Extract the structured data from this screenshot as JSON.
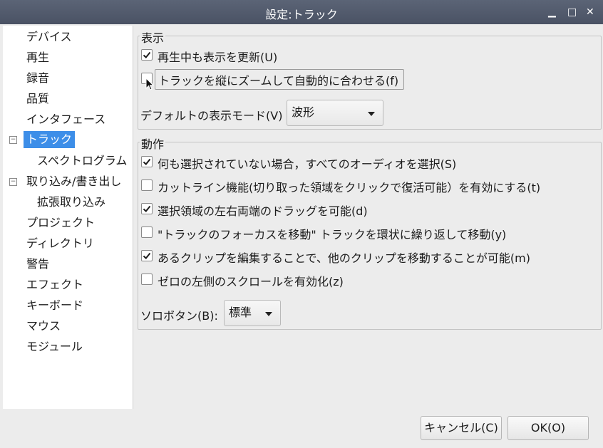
{
  "window": {
    "title": "設定:トラック",
    "minimize_glyph": "▁",
    "maximize_glyph": "□",
    "close_glyph": "✕"
  },
  "sidebar": {
    "items": [
      {
        "label": "デバイス"
      },
      {
        "label": "再生"
      },
      {
        "label": "録音"
      },
      {
        "label": "品質"
      },
      {
        "label": "インタフェース"
      },
      {
        "label": "トラック",
        "selected": true,
        "expanded": true
      },
      {
        "label": "スペクトログラム",
        "child": true
      },
      {
        "label": "取り込み/書き出し",
        "expanded": true
      },
      {
        "label": "拡張取り込み",
        "child": true
      },
      {
        "label": "プロジェクト"
      },
      {
        "label": "ディレクトリ"
      },
      {
        "label": "警告"
      },
      {
        "label": "エフェクト"
      },
      {
        "label": "キーボード"
      },
      {
        "label": "マウス"
      },
      {
        "label": "モジュール"
      }
    ],
    "toggle_glyph": "−"
  },
  "display_group": {
    "title": "表示",
    "update_display": {
      "label": "再生中も表示を更新(U)",
      "checked": true
    },
    "auto_fit": {
      "label": "トラックを縦にズームして自動的に合わせる(f)",
      "checked": false
    },
    "default_view_label": "デフォルトの表示モード(V)",
    "default_view_value": "波形"
  },
  "behavior_group": {
    "title": "動作",
    "options": [
      {
        "label": "何も選択されていない場合，すべてのオーディオを選択(S)",
        "checked": true
      },
      {
        "label": "カットライン機能(切り取った領域をクリックで復活可能）を有効にする(t)",
        "checked": false
      },
      {
        "label": "選択領域の左右両端のドラッグを可能(d)",
        "checked": true
      },
      {
        "label": "\"トラックのフォーカスを移動\" トラックを環状に繰り返して移動(y)",
        "checked": false
      },
      {
        "label": "あるクリップを編集することで、他のクリップを移動することが可能(m)",
        "checked": true
      },
      {
        "label": "ゼロの左側のスクロールを有効化(z)",
        "checked": false
      }
    ],
    "solo_label": "ソロボタン(B):",
    "solo_value": "標準"
  },
  "buttons": {
    "cancel": "キャンセル(C)",
    "ok": "OK(O)"
  },
  "colors": {
    "selection": "#3d8ee8",
    "titlebar": "#4f586a"
  }
}
